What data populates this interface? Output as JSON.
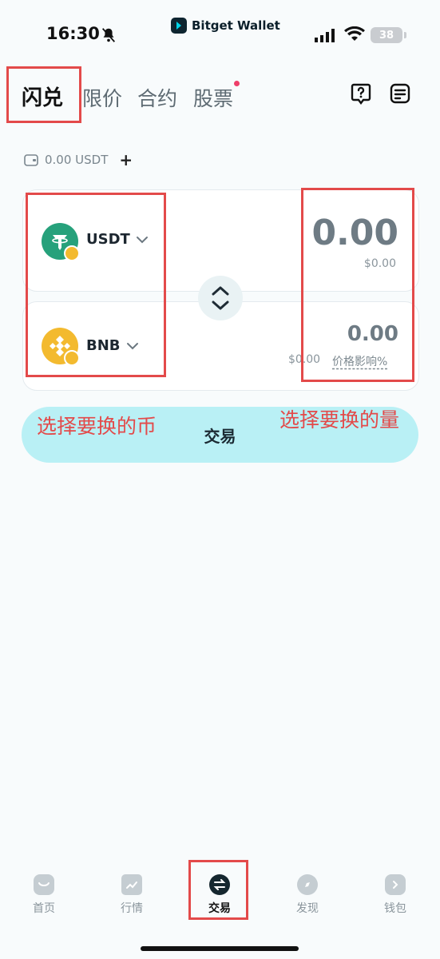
{
  "status": {
    "time": "16:30",
    "battery": "38",
    "app_name": "Bitget Wallet"
  },
  "tabs": [
    {
      "label": "闪兑"
    },
    {
      "label": "限价"
    },
    {
      "label": "合约"
    },
    {
      "label": "股票"
    }
  ],
  "header_icons": [
    "help-icon",
    "orders-icon"
  ],
  "balance": {
    "text": "0.00 USDT",
    "plus": "+"
  },
  "from": {
    "token": "USDT",
    "amount": "0.00",
    "usd": "$0.00",
    "color": "#26a17b"
  },
  "to": {
    "token": "BNB",
    "amount": "0.00",
    "usd": "$0.00",
    "impact_label": "价格影响%",
    "color": "#f3ba2f"
  },
  "trade_button": "交易",
  "annotations": {
    "left": "选择要换的币",
    "right": "选择要换的量",
    "color": "#e34a4a"
  },
  "nav": [
    {
      "label": "首页",
      "icon": "home-icon"
    },
    {
      "label": "行情",
      "icon": "market-icon"
    },
    {
      "label": "交易",
      "icon": "trade-icon"
    },
    {
      "label": "发现",
      "icon": "discover-icon"
    },
    {
      "label": "钱包",
      "icon": "wallet-icon"
    }
  ]
}
